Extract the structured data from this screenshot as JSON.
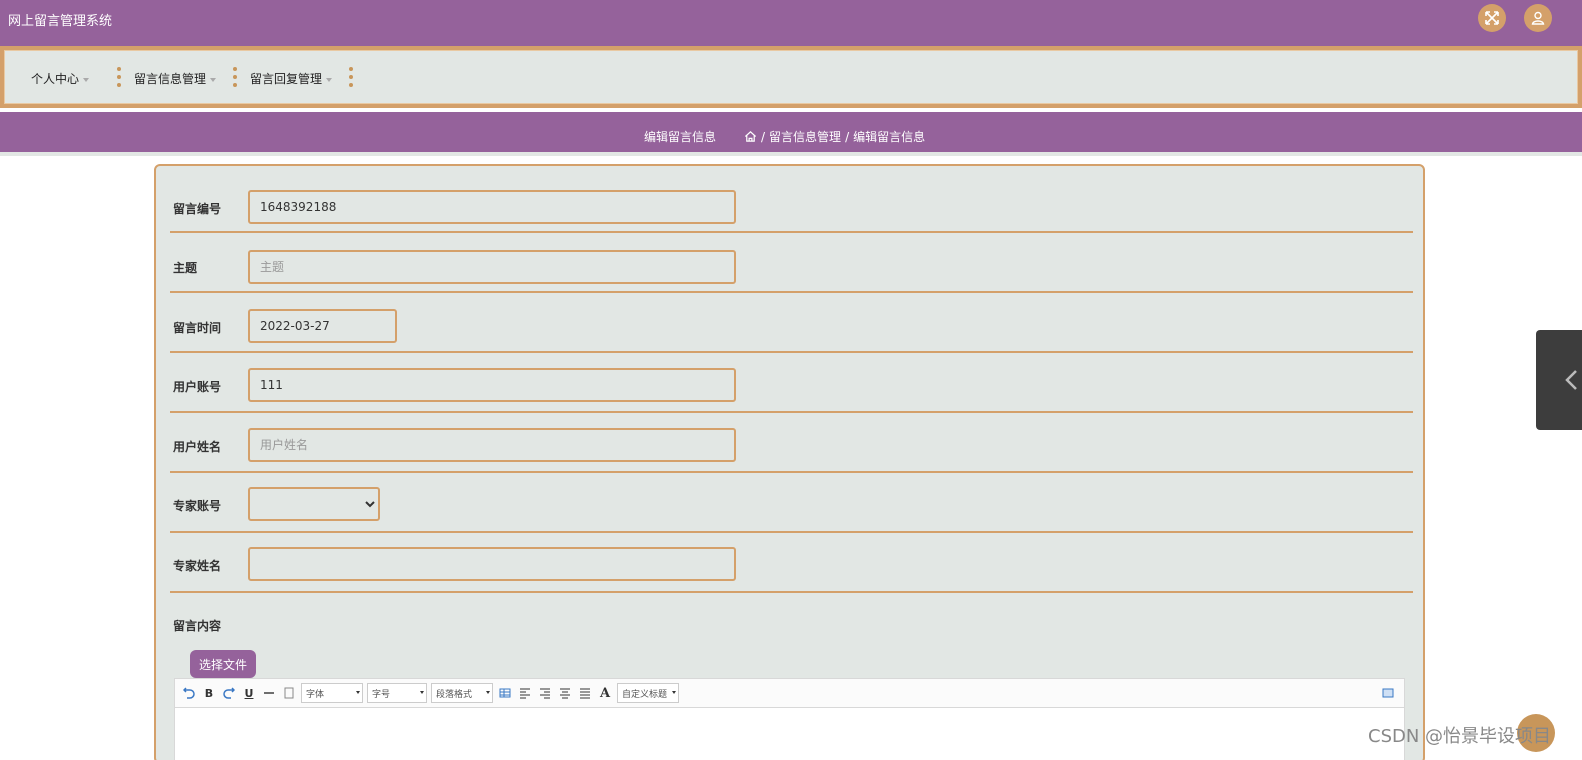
{
  "app": {
    "title": "网上留言管理系统"
  },
  "header_icons": {
    "fullscreen": "fullscreen-icon",
    "user": "user-icon"
  },
  "nav": {
    "items": [
      {
        "label": "个人中心"
      },
      {
        "label": "留言信息管理"
      },
      {
        "label": "留言回复管理"
      }
    ]
  },
  "page": {
    "title": "编辑留言信息",
    "breadcrumb": [
      "留言信息管理",
      "编辑留言信息"
    ],
    "breadcrumb_sep": "/"
  },
  "form": {
    "fields": [
      {
        "label": "留言编号",
        "value": "1648392188",
        "placeholder": ""
      },
      {
        "label": "主题",
        "value": "",
        "placeholder": "主题"
      },
      {
        "label": "留言时间",
        "value": "2022-03-27",
        "placeholder": ""
      },
      {
        "label": "用户账号",
        "value": "111",
        "placeholder": ""
      },
      {
        "label": "用户姓名",
        "value": "",
        "placeholder": "用户姓名"
      },
      {
        "label": "专家账号",
        "value": "",
        "placeholder": ""
      },
      {
        "label": "专家姓名",
        "value": "",
        "placeholder": ""
      },
      {
        "label": "留言内容"
      }
    ],
    "upload_label": "选择文件"
  },
  "editor": {
    "bold": "B",
    "underline": "U",
    "font_color": "A",
    "font_family": "字体",
    "font_size": "字号",
    "paragraph": "段落格式",
    "custom_title": "自定义标题"
  },
  "watermark": "CSDN @怡景毕设项目",
  "colors": {
    "primary": "#95629b",
    "accent": "#d4a06a",
    "panel": "#e2e7e4"
  }
}
